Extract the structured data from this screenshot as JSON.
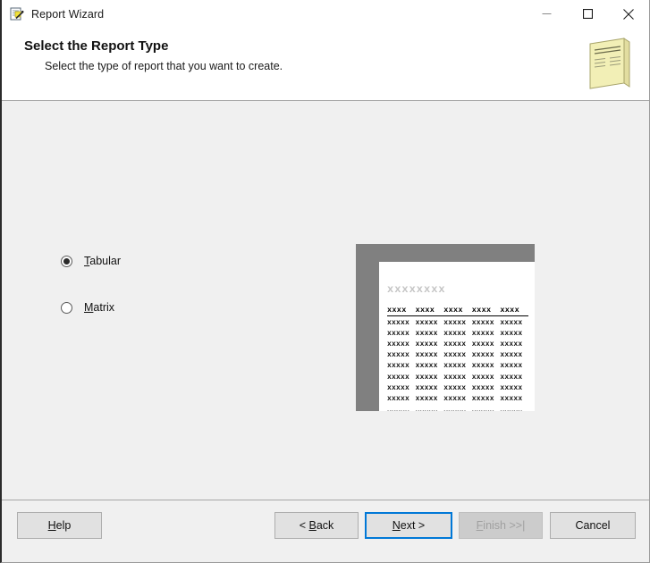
{
  "window": {
    "title": "Report Wizard",
    "icon": "report-wizard-icon",
    "controls": {
      "minimize": "minimize-icon",
      "maximize": "maximize-icon",
      "close": "close-icon"
    }
  },
  "header": {
    "title": "Select the Report Type",
    "subtitle": "Select the type of report that you want to create.",
    "art": "report-document-icon"
  },
  "options": [
    {
      "id": "tabular",
      "label_pre": "",
      "accel": "T",
      "label_post": "abular",
      "checked": true
    },
    {
      "id": "matrix",
      "label_pre": "",
      "accel": "M",
      "label_post": "atrix",
      "checked": false
    }
  ],
  "preview": {
    "title_text": "xxxxxxxx",
    "header_cells": [
      "xxxx",
      "xxxx",
      "xxxx",
      "xxxx",
      "xxxx"
    ],
    "row_cell": "xxxxx",
    "row_count": 11,
    "gap_after_row": 8,
    "backdrop_color": "#808080",
    "page_color": "#ffffff",
    "title_color": "#c4c4c4"
  },
  "footer": {
    "help": {
      "pre": "",
      "accel": "H",
      "post": "elp",
      "enabled": true
    },
    "back": {
      "pre": "< ",
      "accel": "B",
      "post": "ack",
      "enabled": true
    },
    "next": {
      "pre": "",
      "accel": "N",
      "post": "ext >",
      "enabled": true,
      "default": true
    },
    "finish": {
      "pre": "",
      "accel": "F",
      "post": "inish >>|",
      "enabled": false
    },
    "cancel": {
      "pre": "Cancel",
      "accel": "",
      "post": "",
      "enabled": true
    }
  },
  "colors": {
    "accent": "#0078d7",
    "body_bg": "#f0f0f0",
    "panel_bg": "#ffffff",
    "button_bg": "#e1e1e1",
    "disabled_text": "#a0a0a0"
  }
}
